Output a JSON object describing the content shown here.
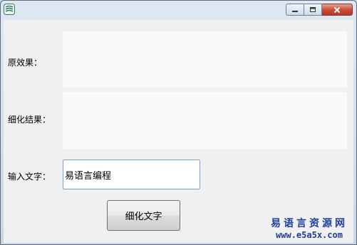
{
  "window": {
    "title": ""
  },
  "labels": {
    "original": "原效果：",
    "thinned": "细化结果：",
    "input": "输入文字："
  },
  "input": {
    "value": "易语言编程"
  },
  "button": {
    "label": "细化文字"
  },
  "watermark": {
    "title": "易语言资源网",
    "url": "www.e5a5x.com"
  },
  "icons": {
    "app": "app-icon",
    "minimize": "minimize-icon",
    "maximize": "maximize-icon",
    "close": "close-icon"
  },
  "colors": {
    "close_button": "#c74a36",
    "watermark": "#1f3f9e",
    "input_border": "#7ea3c9"
  }
}
